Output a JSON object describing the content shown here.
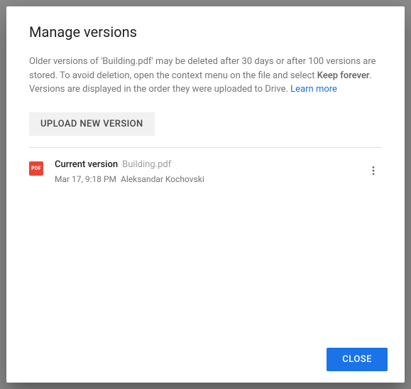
{
  "dialog": {
    "title": "Manage versions",
    "description_prefix": "Older versions of 'Building.pdf' may be deleted after 30 days or after 100 versions are stored. To avoid deletion, open the context menu on the file and select ",
    "description_bold": "Keep forever",
    "description_suffix": ". Versions are displayed in the order they were uploaded to Drive. ",
    "learn_more": "Learn more",
    "upload_button": "UPLOAD NEW VERSION",
    "close_button": "CLOSE"
  },
  "version": {
    "icon_label": "PDF",
    "status": "Current version",
    "filename": "Building.pdf",
    "datetime": "Mar 17, 9:18 PM",
    "uploader": "Aleksandar Kochovski"
  }
}
